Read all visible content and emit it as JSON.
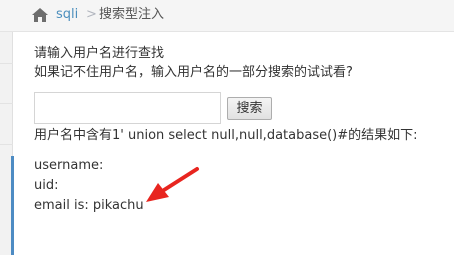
{
  "breadcrumb": {
    "home_icon": "home-icon",
    "link": "sqli",
    "separator": ">",
    "current": "搜索型注入"
  },
  "main": {
    "prompt_line1": "请输入用户名进行查找",
    "prompt_line2": "如果记不住用户名，输入用户名的一部分搜索的试试看?",
    "search_input_value": "",
    "search_button_label": "搜索",
    "result_header": "用户名中含有1' union select null,null,database()#的结果如下:",
    "result_username": "username:",
    "result_uid": "uid:",
    "result_email": "email is: pikachu"
  },
  "colors": {
    "link": "#4c8fbd",
    "arrow": "#e8251f",
    "sidebar_active": "#4d8bc3"
  }
}
